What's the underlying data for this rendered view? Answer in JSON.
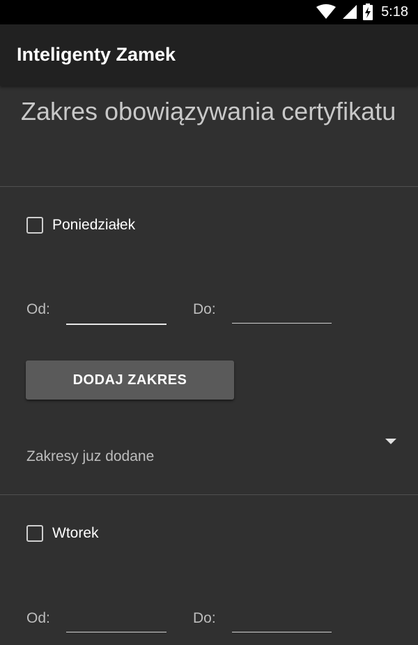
{
  "status_bar": {
    "time": "5:18",
    "icons": [
      "wifi-icon",
      "signal-icon",
      "battery-charging-icon"
    ]
  },
  "app_bar": {
    "title": "Inteligenty Zamek"
  },
  "section": {
    "title": "Zakres obowiązywania certyfikatu"
  },
  "days": [
    {
      "label": "Poniedziałek",
      "checked": false,
      "from_label": "Od:",
      "from_value": "",
      "to_label": "Do:",
      "to_value": "",
      "add_button": "DODAJ ZAKRES",
      "spinner_label": "Zakresy juz dodane"
    },
    {
      "label": "Wtorek",
      "checked": false,
      "from_label": "Od:",
      "from_value": "",
      "to_label": "Do:",
      "to_value": ""
    }
  ],
  "colors": {
    "background": "#303030",
    "app_bar": "#212121",
    "status_bar": "#000000",
    "button": "#5a5a5a"
  }
}
